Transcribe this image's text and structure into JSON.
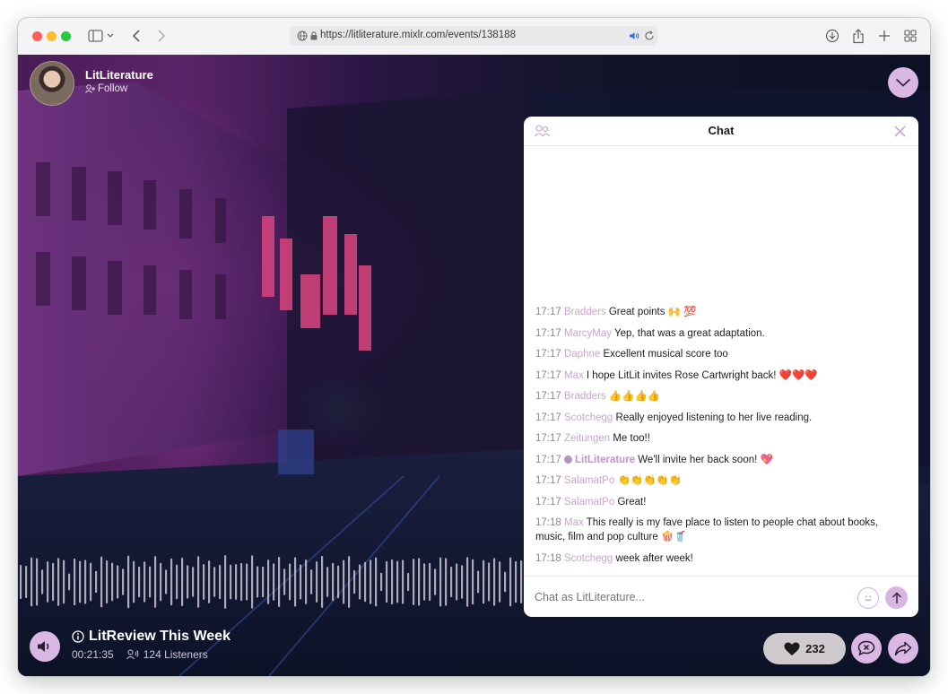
{
  "browser": {
    "url": "https://litliterature.mixlr.com/events/138188"
  },
  "channel": {
    "name": "LitLiterature",
    "follow_label": "Follow"
  },
  "chat": {
    "title": "Chat",
    "input_placeholder": "Chat as LitLiterature...",
    "messages": [
      {
        "time": "17:17",
        "user": "Bradders",
        "text": "Great points 🙌 💯",
        "host": false
      },
      {
        "time": "17:17",
        "user": "MarcyMay",
        "text": "Yep, that was a great adaptation.",
        "host": false
      },
      {
        "time": "17:17",
        "user": "Daphne",
        "text": "Excellent musical score too",
        "host": false
      },
      {
        "time": "17:17",
        "user": "Max",
        "text": "I hope LitLit invites Rose Cartwright back! ❤️❤️❤️",
        "host": false
      },
      {
        "time": "17:17",
        "user": "Bradders",
        "text": "👍👍👍👍",
        "host": false
      },
      {
        "time": "17:17",
        "user": "Scotchegg",
        "text": "Really enjoyed listening to her live reading.",
        "host": false
      },
      {
        "time": "17:17",
        "user": "Zeitungen",
        "text": "Me too!!",
        "host": false
      },
      {
        "time": "17:17",
        "user": "LitLiterature",
        "text": "We'll invite her back soon! 💖",
        "host": true
      },
      {
        "time": "17:17",
        "user": "SalamatPo",
        "text": "👏👏👏👏👏",
        "host": false
      },
      {
        "time": "17:17",
        "user": "SalamatPo",
        "text": "Great!",
        "host": false
      },
      {
        "time": "17:18",
        "user": "Max",
        "text": "This really is my fave place to listen to people chat about books, music, film and pop culture 🍿🥤",
        "host": false
      },
      {
        "time": "17:18",
        "user": "Scotchegg",
        "text": "week after week!",
        "host": false
      }
    ]
  },
  "player": {
    "show_title": "LitReview This Week",
    "elapsed": "00:21:35",
    "listeners": "124 Listeners",
    "likes": "232"
  },
  "colors": {
    "accent": "#d9b8e3",
    "username": "#c9a6cf"
  }
}
